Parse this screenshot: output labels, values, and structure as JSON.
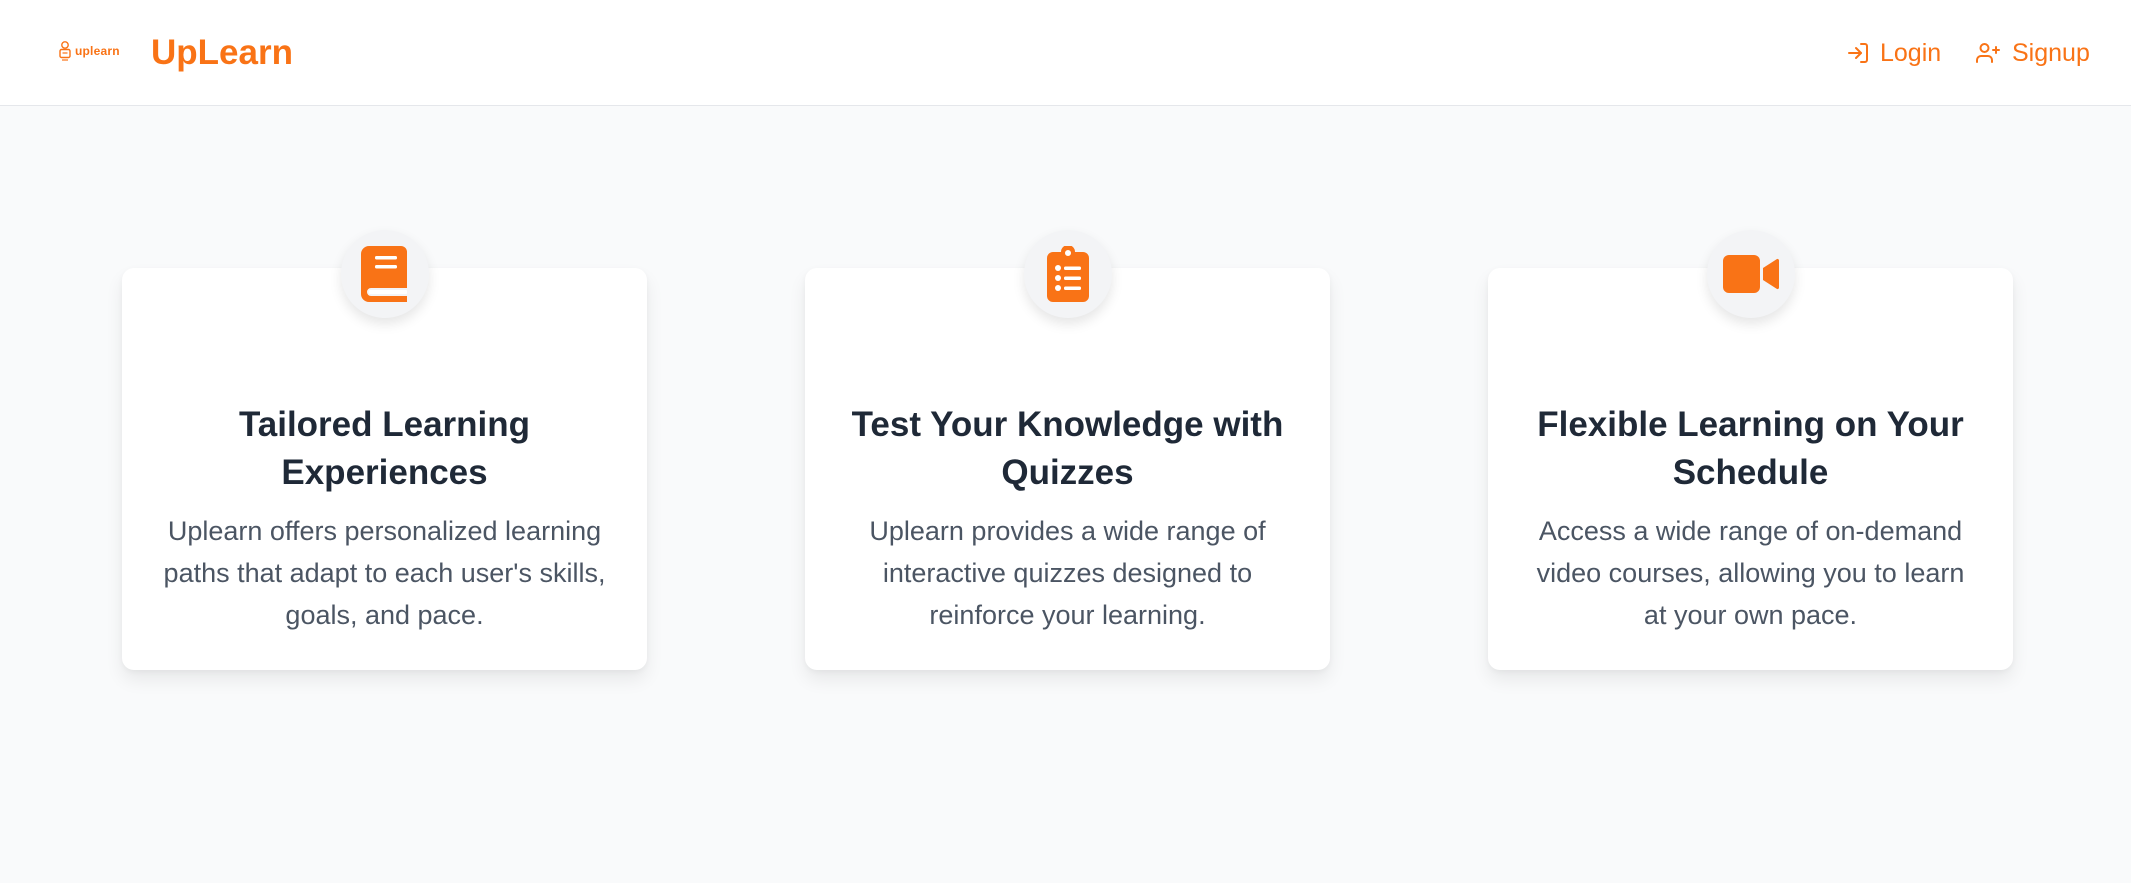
{
  "header": {
    "logo_text": "uplearn",
    "brand": "UpLearn",
    "login_label": "Login",
    "signup_label": "Signup"
  },
  "features": [
    {
      "icon": "book-icon",
      "title": "Tailored Learning Experiences",
      "description": "Uplearn offers personalized learning paths that adapt to each user's skills, goals, and pace."
    },
    {
      "icon": "clipboard-list-icon",
      "title": "Test Your Knowledge with Quizzes",
      "description": "Uplearn provides a wide range of interactive quizzes designed to reinforce your learning."
    },
    {
      "icon": "video-icon",
      "title": "Flexible Learning on Your Schedule",
      "description": "Access a wide range of on-demand video courses, allowing you to learn at your own pace."
    }
  ],
  "colors": {
    "accent": "#f97316",
    "background": "#f9fafb",
    "card": "#ffffff",
    "title_text": "#1f2937",
    "body_text": "#4b5563"
  }
}
